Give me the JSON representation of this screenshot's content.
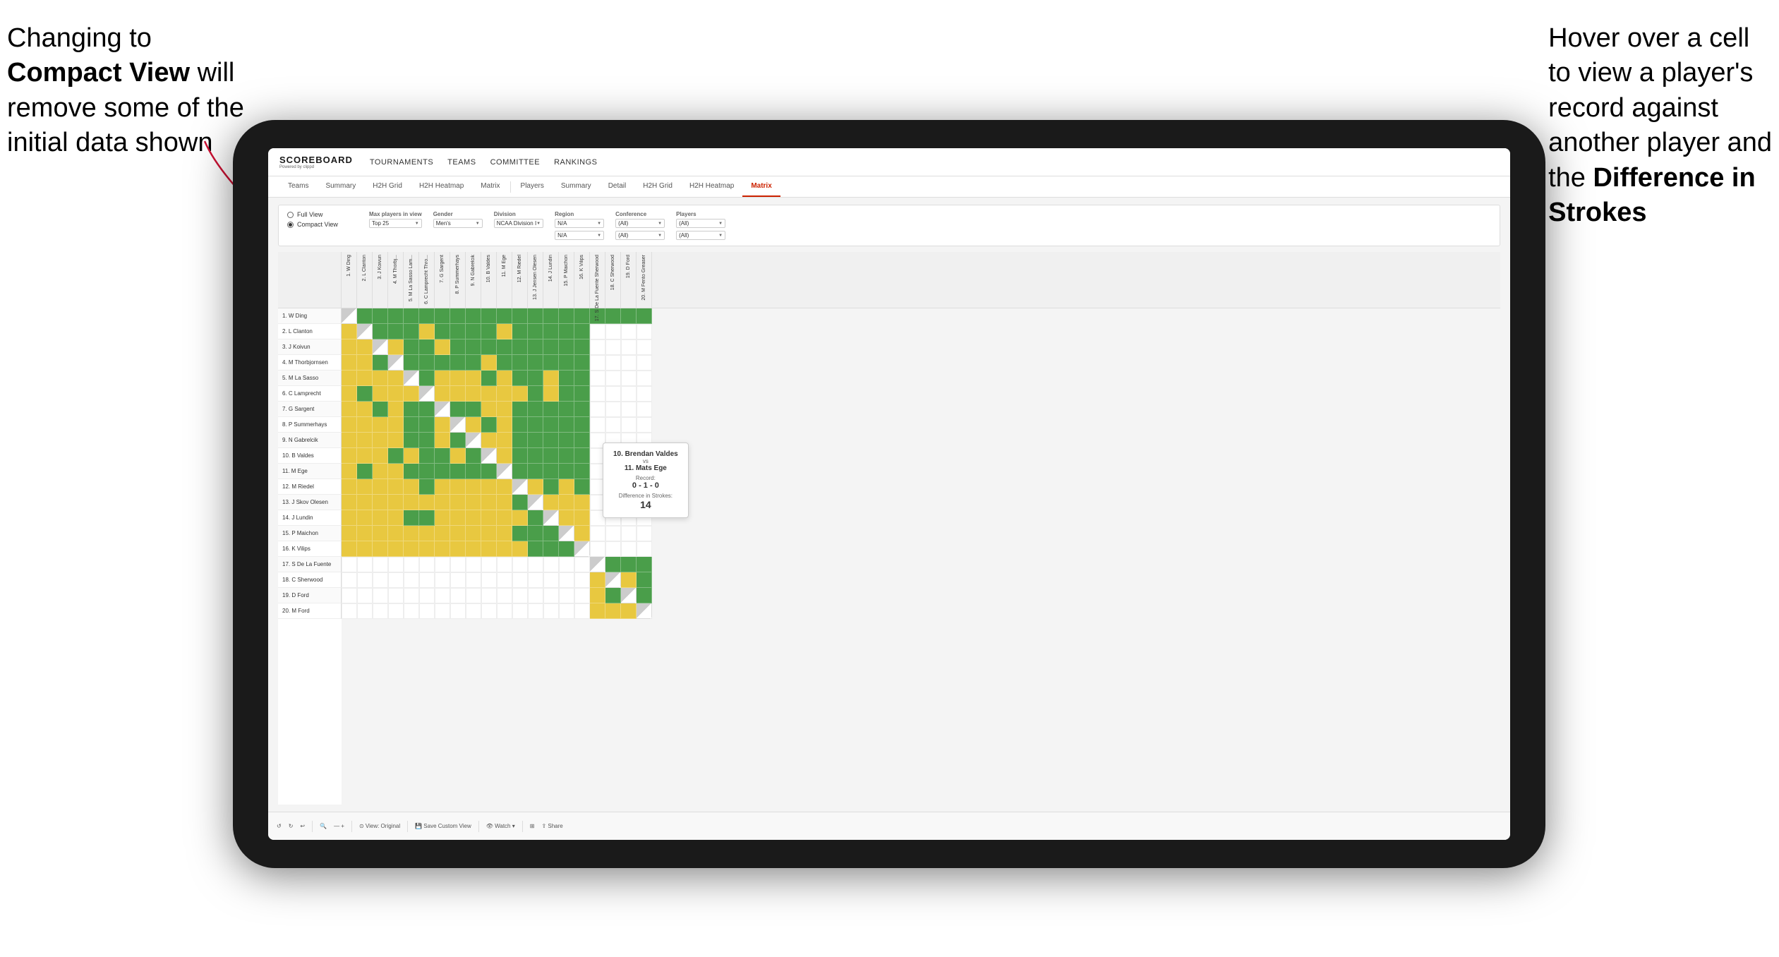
{
  "annotations": {
    "left": {
      "line1": "Changing to",
      "line2bold": "Compact View",
      "line2rest": " will",
      "line3": "remove some of the",
      "line4": "initial data shown"
    },
    "right": {
      "line1": "Hover over a cell",
      "line2": "to view a player's",
      "line3": "record against",
      "line4": "another player and",
      "line5bold": "the ",
      "line5boldpart": "Difference in",
      "line6bold": "Strokes"
    }
  },
  "app": {
    "logo": "SCOREBOARD",
    "logo_sub": "Powered by clippd",
    "nav_items": [
      "TOURNAMENTS",
      "TEAMS",
      "COMMITTEE",
      "RANKINGS"
    ]
  },
  "sub_nav_groups": [
    {
      "tabs": [
        {
          "label": "Teams",
          "active": false
        },
        {
          "label": "Summary",
          "active": false
        },
        {
          "label": "H2H Grid",
          "active": false
        },
        {
          "label": "H2H Heatmap",
          "active": false
        },
        {
          "label": "Matrix",
          "active": false
        }
      ]
    },
    {
      "tabs": [
        {
          "label": "Players",
          "active": false
        },
        {
          "label": "Summary",
          "active": false
        },
        {
          "label": "Detail",
          "active": false
        },
        {
          "label": "H2H Grid",
          "active": false
        },
        {
          "label": "H2H Heatmap",
          "active": false
        },
        {
          "label": "Matrix",
          "active": true
        }
      ]
    }
  ],
  "filters": {
    "view_options": {
      "label": "View",
      "full_view": "Full View",
      "compact_view": "Compact View",
      "selected": "compact"
    },
    "max_players": {
      "label": "Max players in view",
      "value": "Top 25"
    },
    "gender": {
      "label": "Gender",
      "value": "Men's"
    },
    "division": {
      "label": "Division",
      "value": "NCAA Division I"
    },
    "region": {
      "label": "Region",
      "value": "N/A",
      "value2": "N/A"
    },
    "conference": {
      "label": "Conference",
      "value": "(All)",
      "value2": "(All)"
    },
    "players": {
      "label": "Players",
      "value": "(All)",
      "value2": "(All)"
    }
  },
  "players": [
    "1. W Ding",
    "2. L Clanton",
    "3. J Koivun",
    "4. M Thorbjornsen",
    "5. M La Sasso",
    "6. C Lamprecht",
    "7. G Sargent",
    "8. P Summerhays",
    "9. N Gabrelcik",
    "10. B Valdes",
    "11. M Ege",
    "12. M Riedel",
    "13. J Skov Olesen",
    "14. J Lundin",
    "15. P Maichon",
    "16. K Vilips",
    "17. S De La Fuente",
    "18. C Sherwood",
    "19. D Ford",
    "20. M Ford"
  ],
  "col_headers": [
    "1. W Ding",
    "2. L Clanton",
    "3. J Koivun",
    "4. M Thorbj...",
    "5. M La Sasso Lam...",
    "6. C Lamprecht Thro...",
    "7. G Sargent",
    "8. P Summerhays",
    "9. N Gabrelcik",
    "10. B Valdes",
    "11. M Ege",
    "12. M Riedel",
    "13. J Jensen Olesen",
    "14. J Lundin",
    "15. P Maichon",
    "16. K Vilips",
    "17. S De La Fuente Sherwood",
    "18. C Sherwood",
    "19. D Ford",
    "20. M Fento Greaser"
  ],
  "tooltip": {
    "player1": "10. Brendan Valdes",
    "vs": "vs",
    "player2": "11. Mats Ege",
    "record_label": "Record:",
    "record": "0 - 1 - 0",
    "diff_label": "Difference in Strokes:",
    "diff": "14"
  },
  "toolbar": {
    "undo": "↺",
    "redo": "↻",
    "view_original": "View: Original",
    "save_custom": "Save Custom View",
    "watch": "Watch ▾",
    "share": "Share"
  }
}
